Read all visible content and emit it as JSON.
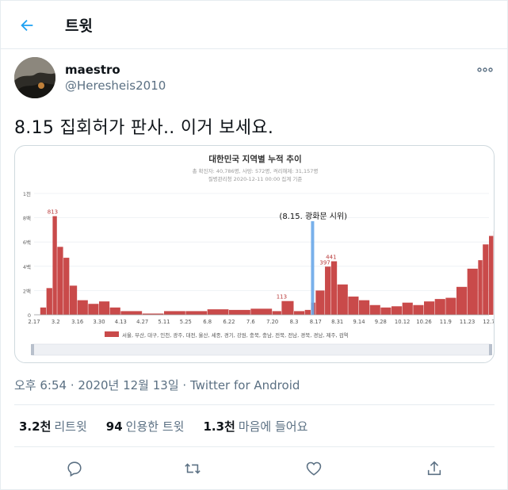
{
  "header": {
    "title": "트윗"
  },
  "tweet": {
    "display_name": "maestro",
    "handle": "@Heresheis2010",
    "text": "8.15 집회허가 판사.. 이거 보세요.",
    "timestamp": "오후 6:54 · 2020년 12월 13일 · ",
    "source": "Twitter for Android"
  },
  "stats": {
    "retweets_value": "3.2천",
    "retweets_label": "리트윗",
    "quotes_value": "94",
    "quotes_label": "인용한 트윗",
    "likes_value": "1.3천",
    "likes_label": "마음에 들어요"
  },
  "icons": {
    "back": "arrow-left-icon",
    "more": "more-icon",
    "reply": "reply-icon",
    "retweet": "retweet-icon",
    "like": "heart-icon",
    "share": "share-icon"
  },
  "colors": {
    "accent": "#1da1f2",
    "bar": "#c94a4a",
    "marker": "#6aa9e9",
    "secondary_text": "#5b7083"
  },
  "chart_data": {
    "type": "bar",
    "title": "대한민국 지역별 누적 추이",
    "subtitle_1": "총 확진자: 40,786명, 사망: 572명, 격리해제: 31,157명",
    "subtitle_2": "질병관리청 2020-12-11 00:00 집계 기준",
    "annotation": "(8.15. 광화문 시위)",
    "annotation_date": "8.15",
    "y_ticks": [
      "1천",
      "8백",
      "6백",
      "4백",
      "2백",
      "0"
    ],
    "ylim": [
      0,
      1000
    ],
    "x_ticks": [
      "2.17",
      "3.2",
      "3.16",
      "3.30",
      "4.13",
      "4.27",
      "5.11",
      "5.25",
      "6.8",
      "6.22",
      "7.6",
      "7.20",
      "8.3",
      "8.17",
      "8.31",
      "9.14",
      "9.28",
      "10.12",
      "10.26",
      "11.9",
      "11.23",
      "12.7"
    ],
    "values": [
      {
        "x": "2.17",
        "y": 0
      },
      {
        "x": "2.21",
        "y": 60
      },
      {
        "x": "2.25",
        "y": 220
      },
      {
        "x": "2.29",
        "y": 813
      },
      {
        "x": "3.3",
        "y": 560
      },
      {
        "x": "3.7",
        "y": 470
      },
      {
        "x": "3.11",
        "y": 240
      },
      {
        "x": "3.16",
        "y": 120
      },
      {
        "x": "3.23",
        "y": 90
      },
      {
        "x": "3.30",
        "y": 110
      },
      {
        "x": "4.6",
        "y": 60
      },
      {
        "x": "4.13",
        "y": 30
      },
      {
        "x": "4.27",
        "y": 10
      },
      {
        "x": "5.11",
        "y": 30
      },
      {
        "x": "5.25",
        "y": 30
      },
      {
        "x": "6.8",
        "y": 45
      },
      {
        "x": "6.22",
        "y": 40
      },
      {
        "x": "7.6",
        "y": 50
      },
      {
        "x": "7.20",
        "y": 30
      },
      {
        "x": "7.26",
        "y": 113
      },
      {
        "x": "8.3",
        "y": 30
      },
      {
        "x": "8.10",
        "y": 40
      },
      {
        "x": "8.14",
        "y": 100
      },
      {
        "x": "8.17",
        "y": 200
      },
      {
        "x": "8.23",
        "y": 397
      },
      {
        "x": "8.27",
        "y": 441
      },
      {
        "x": "8.31",
        "y": 250
      },
      {
        "x": "9.7",
        "y": 150
      },
      {
        "x": "9.14",
        "y": 120
      },
      {
        "x": "9.21",
        "y": 80
      },
      {
        "x": "9.28",
        "y": 60
      },
      {
        "x": "10.5",
        "y": 70
      },
      {
        "x": "10.12",
        "y": 100
      },
      {
        "x": "10.19",
        "y": 80
      },
      {
        "x": "10.26",
        "y": 110
      },
      {
        "x": "11.2",
        "y": 130
      },
      {
        "x": "11.9",
        "y": 140
      },
      {
        "x": "11.16",
        "y": 230
      },
      {
        "x": "11.23",
        "y": 380
      },
      {
        "x": "11.30",
        "y": 450
      },
      {
        "x": "12.3",
        "y": 580
      },
      {
        "x": "12.7",
        "y": 650
      },
      {
        "x": "12.10",
        "y": 690
      }
    ],
    "point_labels": [
      {
        "x": "2.29",
        "y": 813,
        "text": "813"
      },
      {
        "x": "7.26",
        "y": 113,
        "text": "113"
      },
      {
        "x": "8.23",
        "y": 397,
        "text": "397"
      },
      {
        "x": "8.27",
        "y": 441,
        "text": "441"
      }
    ],
    "legend": "서울, 부산, 대구, 인천, 광주, 대전, 울산, 세종, 경기, 강원, 충북, 충남, 전북, 전남, 경북, 경남, 제주, 검역",
    "legend_position": "bottom",
    "grid": true
  }
}
